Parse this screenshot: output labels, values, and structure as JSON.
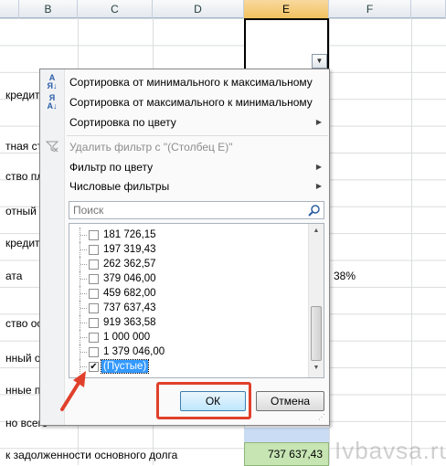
{
  "sheet": {
    "columns": [
      "B",
      "C",
      "D",
      "E",
      "F"
    ],
    "row_labels": [
      "кредит",
      "тная ст",
      "ство пл",
      "отный а",
      "кредит",
      "ата",
      "ство ос",
      "нный о",
      "нные п",
      "но всего",
      "к задолженности основного долга"
    ],
    "f_cell_value": "38%",
    "e_cell_value": "737 637,43"
  },
  "menu": {
    "sort_asc": "Сортировка от минимального к максимальному",
    "sort_desc": "Сортировка от максимального к минимальному",
    "sort_color": "Сортировка по цвету",
    "clear_filter": "Удалить фильтр с \"(Столбец E)\"",
    "filter_color": "Фильтр по цвету",
    "number_filters": "Числовые фильтры"
  },
  "search": {
    "placeholder": "Поиск"
  },
  "list": [
    {
      "label": "181 726,15",
      "checked": false
    },
    {
      "label": "197 319,43",
      "checked": false
    },
    {
      "label": "262 362,57",
      "checked": false
    },
    {
      "label": "379 046,00",
      "checked": false
    },
    {
      "label": "459 682,00",
      "checked": false
    },
    {
      "label": "737 637,43",
      "checked": false
    },
    {
      "label": "919 363,58",
      "checked": false
    },
    {
      "label": "1 000 000",
      "checked": false
    },
    {
      "label": "1 379 046,00",
      "checked": false
    },
    {
      "label": "(Пустые)",
      "checked": true
    }
  ],
  "buttons": {
    "ok": "ОК",
    "cancel": "Отмена"
  },
  "watermark": "Ivbavsa.ru",
  "colors": {
    "annotation_red": "#e0402b",
    "highlight_blue": "#3399ff",
    "green_cell": "#c6e5b3"
  }
}
